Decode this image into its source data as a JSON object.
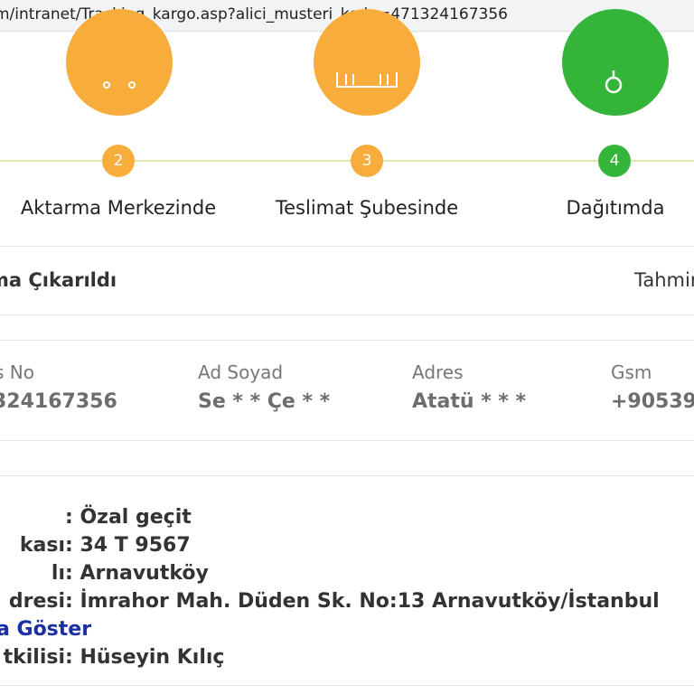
{
  "browser": {
    "url": "m/intranet/Tracking_kargo.asp?alici_musteri_kodu=471324167356"
  },
  "progress": {
    "steps": [
      {
        "number": "2",
        "label": "Aktarma Merkezinde",
        "color": "#f7ac3c",
        "icon": "transfer-truck-icon"
      },
      {
        "number": "3",
        "label": "Teslimat Şubesinde",
        "color": "#f7ac3c",
        "icon": "branch-building-icon"
      },
      {
        "number": "4",
        "label": "Dağıtımda",
        "color": "#35b43a",
        "icon": "courier-person-icon"
      }
    ]
  },
  "status": {
    "text": "ma Çıkarıldı",
    "estimate_label": "Tahmin"
  },
  "recipient": {
    "labels": [
      "s No",
      "Ad Soyad",
      "Adres",
      "Gsm"
    ],
    "values": [
      "324167356",
      "Se * * Çe * *",
      "Atatü * * *",
      "+90539"
    ]
  },
  "details": {
    "rows": [
      {
        "label": "",
        "value": ": Özal geçit"
      },
      {
        "label": "kası",
        "value": ": 34 T 9567"
      },
      {
        "label": "lı",
        "value": ": Arnavutköy"
      },
      {
        "label": "dresi",
        "value": ": İmrahor Mah. Düden Sk. No:13 Arnavutköy/İstanbul"
      }
    ],
    "map_link": "a Göster",
    "contact": {
      "label": "tkilisi",
      "value": ": Hüseyin Kılıç"
    }
  },
  "colors": {
    "orange": "#f7ac3c",
    "green": "#35b43a",
    "link": "#1a2fa3"
  }
}
